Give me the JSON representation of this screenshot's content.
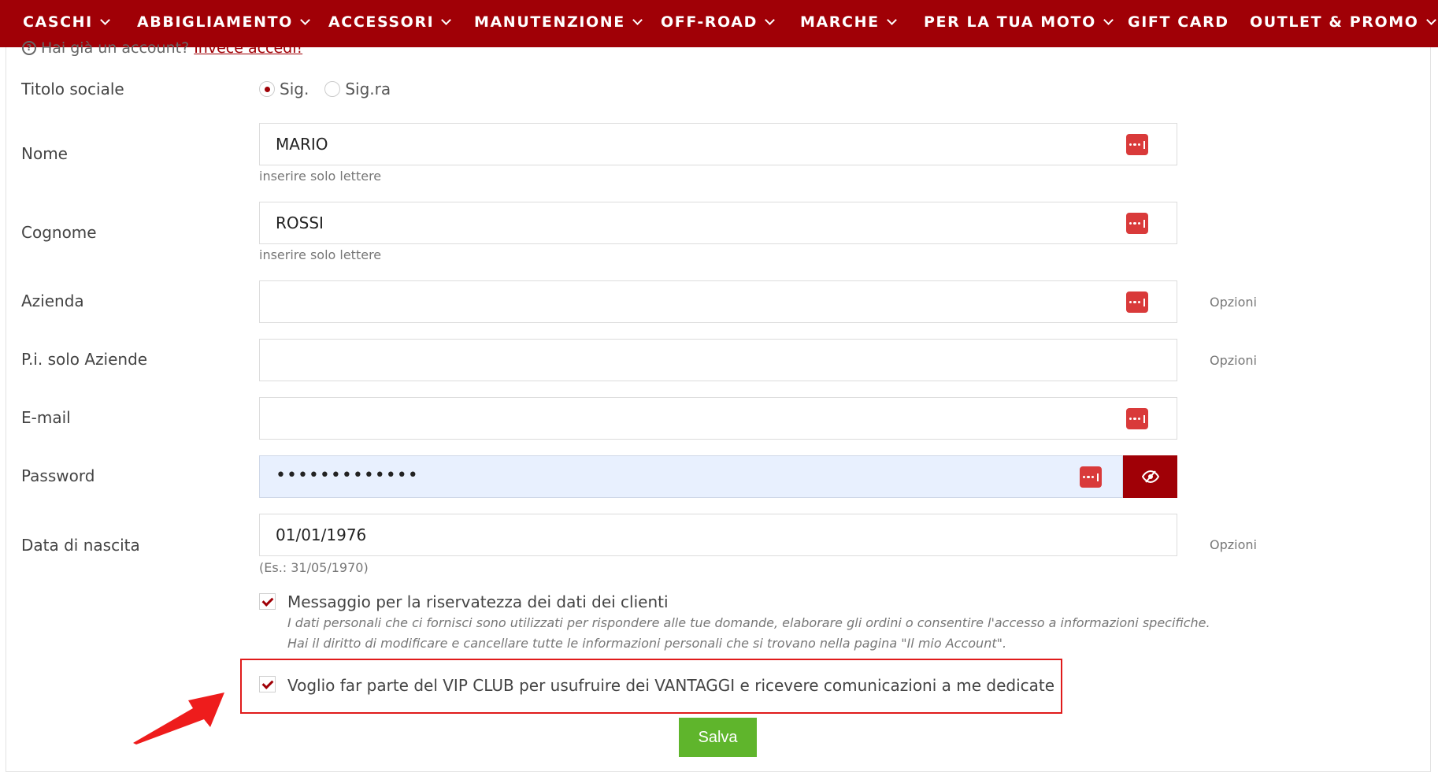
{
  "nav": {
    "items": [
      {
        "label": "CASCHI",
        "dropdown": true
      },
      {
        "label": "ABBIGLIAMENTO",
        "dropdown": true
      },
      {
        "label": "ACCESSORI",
        "dropdown": true
      },
      {
        "label": "MANUTENZIONE",
        "dropdown": true
      },
      {
        "label": "OFF-ROAD",
        "dropdown": true
      },
      {
        "label": "MARCHE",
        "dropdown": true
      },
      {
        "label": "PER LA TUA MOTO",
        "dropdown": true
      },
      {
        "label": "GIFT CARD",
        "dropdown": false
      },
      {
        "label": "OUTLET & PROMO",
        "dropdown": true
      }
    ]
  },
  "account": {
    "question": "Hai già un account?",
    "link": "Invece accedi!"
  },
  "form": {
    "title_label": "Titolo sociale",
    "title_options": [
      "Sig.",
      "Sig.ra"
    ],
    "title_selected": "Sig.",
    "first_name": {
      "label": "Nome",
      "value": "MARIO",
      "help": "inserire solo lettere"
    },
    "last_name": {
      "label": "Cognome",
      "value": "ROSSI",
      "help": "inserire solo lettere"
    },
    "company": {
      "label": "Azienda",
      "value": "",
      "optional": "Opzioni"
    },
    "vat": {
      "label": "P.i. solo Aziende",
      "value": "",
      "optional": "Opzioni"
    },
    "email": {
      "label": "E-mail",
      "value": ""
    },
    "password": {
      "label": "Password",
      "value": "•••••••••••••"
    },
    "birthdate": {
      "label": "Data di nascita",
      "value": "01/01/1976",
      "help": "(Es.: 31/05/1970)",
      "optional": "Opzioni"
    },
    "privacy": {
      "checked": true,
      "label": "Messaggio per la riservatezza dei dati dei clienti",
      "text_line1": "I dati personali che ci fornisci sono utilizzati per rispondere alle tue domande, elaborare gli ordini o consentire l'accesso a informazioni specifiche.",
      "text_line2": "Hai il diritto di modificare e cancellare tutte le informazioni personali che si trovano nella pagina \"Il mio Account\"."
    },
    "vip": {
      "checked": true,
      "label": "Voglio far parte del VIP CLUB per usufruire dei VANTAGGI e ricevere comunicazioni a me dedicate"
    },
    "save_label": "Salva"
  },
  "colors": {
    "brand": "#a00006",
    "save": "#5fb52c",
    "highlight": "#e01b1b",
    "password_manager_icon": "#d93a3a"
  },
  "icons": {
    "nav_dropdown": "chevron-down-icon",
    "password_manager": "password-manager-icon",
    "toggle_password": "eye-slash-icon",
    "annotation": "red-arrow-icon"
  }
}
